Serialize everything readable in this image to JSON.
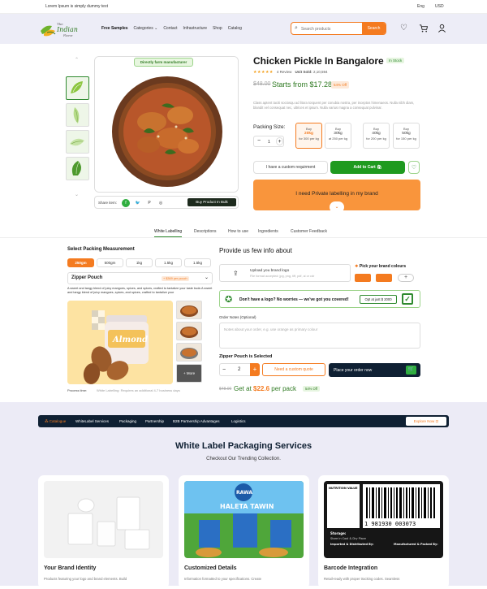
{
  "topbar": {
    "text": "Lorem Ipsum is simply dummy text",
    "lang": "Eng",
    "currency": "USD"
  },
  "header": {
    "nav": [
      "Free Samples",
      "Categories",
      "Contact",
      "Infrastructure",
      "Shop",
      "Catalog"
    ],
    "search_placeholder": "Search products",
    "search_button": "Search",
    "logo_lines": [
      "The",
      "Indian",
      "Flavor"
    ]
  },
  "product": {
    "tag": "Directly farm manufacturer",
    "title": "Chicken Pickle In Bangalore",
    "stock": "In Stock",
    "stars": "★★★★★",
    "reviews": "4 Review",
    "unit_sold_label": "Unit Sold:",
    "unit_sold": "2,10,594",
    "old_price": "$48.00",
    "price": "Starts from $17.28",
    "discount": "54% Off",
    "description": "Class aptent taciti sociosqu ad litora torquent per conubia nostra, per inceptos himenaeos. Nulla nibh diam, blandit vel consequat nec, ultrices et ipsum. Nulla varius magna a consequat pulvinar.",
    "packing_label": "Packing Size:",
    "qty": "1",
    "packs": [
      {
        "buy": "Buy",
        "weight": "20kg",
        "rate": "for 300 per kg"
      },
      {
        "buy": "Buy",
        "weight": "30kg",
        "rate": "at 250 per kg"
      },
      {
        "buy": "Buy",
        "weight": "40kg",
        "rate": "for 200 per kg"
      },
      {
        "buy": "Buy",
        "weight": "50kg",
        "rate": "for 150 per kg"
      }
    ],
    "custom_req": "I have a custom requirment",
    "add_to_cart": "Add to Cart",
    "private_banner": "I need Private labelling  in my brand",
    "share_label": "Share item:",
    "buy_bulk": "Buy Product In Bulk"
  },
  "tabs": [
    "White Labelling",
    "Descriptions",
    "How to use",
    "Ingredients",
    "Customer Feedback"
  ],
  "packing": {
    "title": "Select Packing Measurement",
    "weights": [
      "250gm",
      "500gm",
      "1kg",
      "1.5kg",
      "1.5kg"
    ],
    "pouch": "Zipper Pouch",
    "pouch_badge": "+ $369 per pouch",
    "pouch_desc": "A sweet and tangy blend of juicy mangoes, spices, and spices, crafted to tantalize your taste buds A sweet and tangy blend of juicy mangoes, spices, and spices, crafted to tantalize your",
    "brand_text": "Almond",
    "more": "+ More",
    "process_label": "Process time:",
    "process_value": "White Labelling: Requires an additional 4-7 business days"
  },
  "info": {
    "title": "Provide us few info about",
    "upload_title": "Upload you brand logo",
    "upload_sub": "File format accepted: jpg, png, tiff, pdf, ai or cdr",
    "colours_label": "Pick your brand colours",
    "colours": [
      "#f47b20",
      "#f47b20"
    ],
    "no_logo": "Don't have a logo? No worries — we've got you covered!",
    "opt": "Opt at just $ 2000",
    "notes_label": "Order Notes (Optional)",
    "notes_placeholder": "Notes about your order, e.g. use orange as primary colour",
    "selected": "Zipper Pouch is Selected",
    "qty": "2",
    "quote": "Need a custom quote",
    "place_order": "Place your order now",
    "old_price": "$48.00",
    "get_at": "Get at",
    "per_pack_price": "$22.6",
    "per_pack": "per pack",
    "off": "54% Off"
  },
  "catbar": {
    "first": "Catalogue",
    "items": [
      "WhiteLabel Services",
      "Packaging",
      "Partnership",
      "B2B Partnership Advantages",
      "Logistics"
    ],
    "explore": "Explore Now"
  },
  "services": {
    "title": "White Label Packaging Services",
    "subtitle": "Checkout Our Trending Collection.",
    "cards": [
      {
        "title": "Your Brand Identity",
        "desc": "Products featuring your logo and brand elements. Build"
      },
      {
        "title": "Customized Details",
        "desc": "Information formatted to your specifications. Create"
      },
      {
        "title": "Barcode Integration",
        "desc": "Retail-ready with proper tracking codes. Seamless"
      }
    ],
    "pack_brand": "RAWA",
    "pack_name": "HALETA TAWIN",
    "barcode_number": "1 981930 003073",
    "nutrition": "NUTRITION VALUE",
    "storage": "Storage:",
    "storage_desc": "Store in Cool & Dry Place",
    "imported_by": "Imported & Distributed By:",
    "manufactured_by": "Manufactured & Packed By:"
  },
  "colors": {
    "accent": "#f47b20",
    "green": "#2f8a2f",
    "navy": "#0f2033"
  }
}
